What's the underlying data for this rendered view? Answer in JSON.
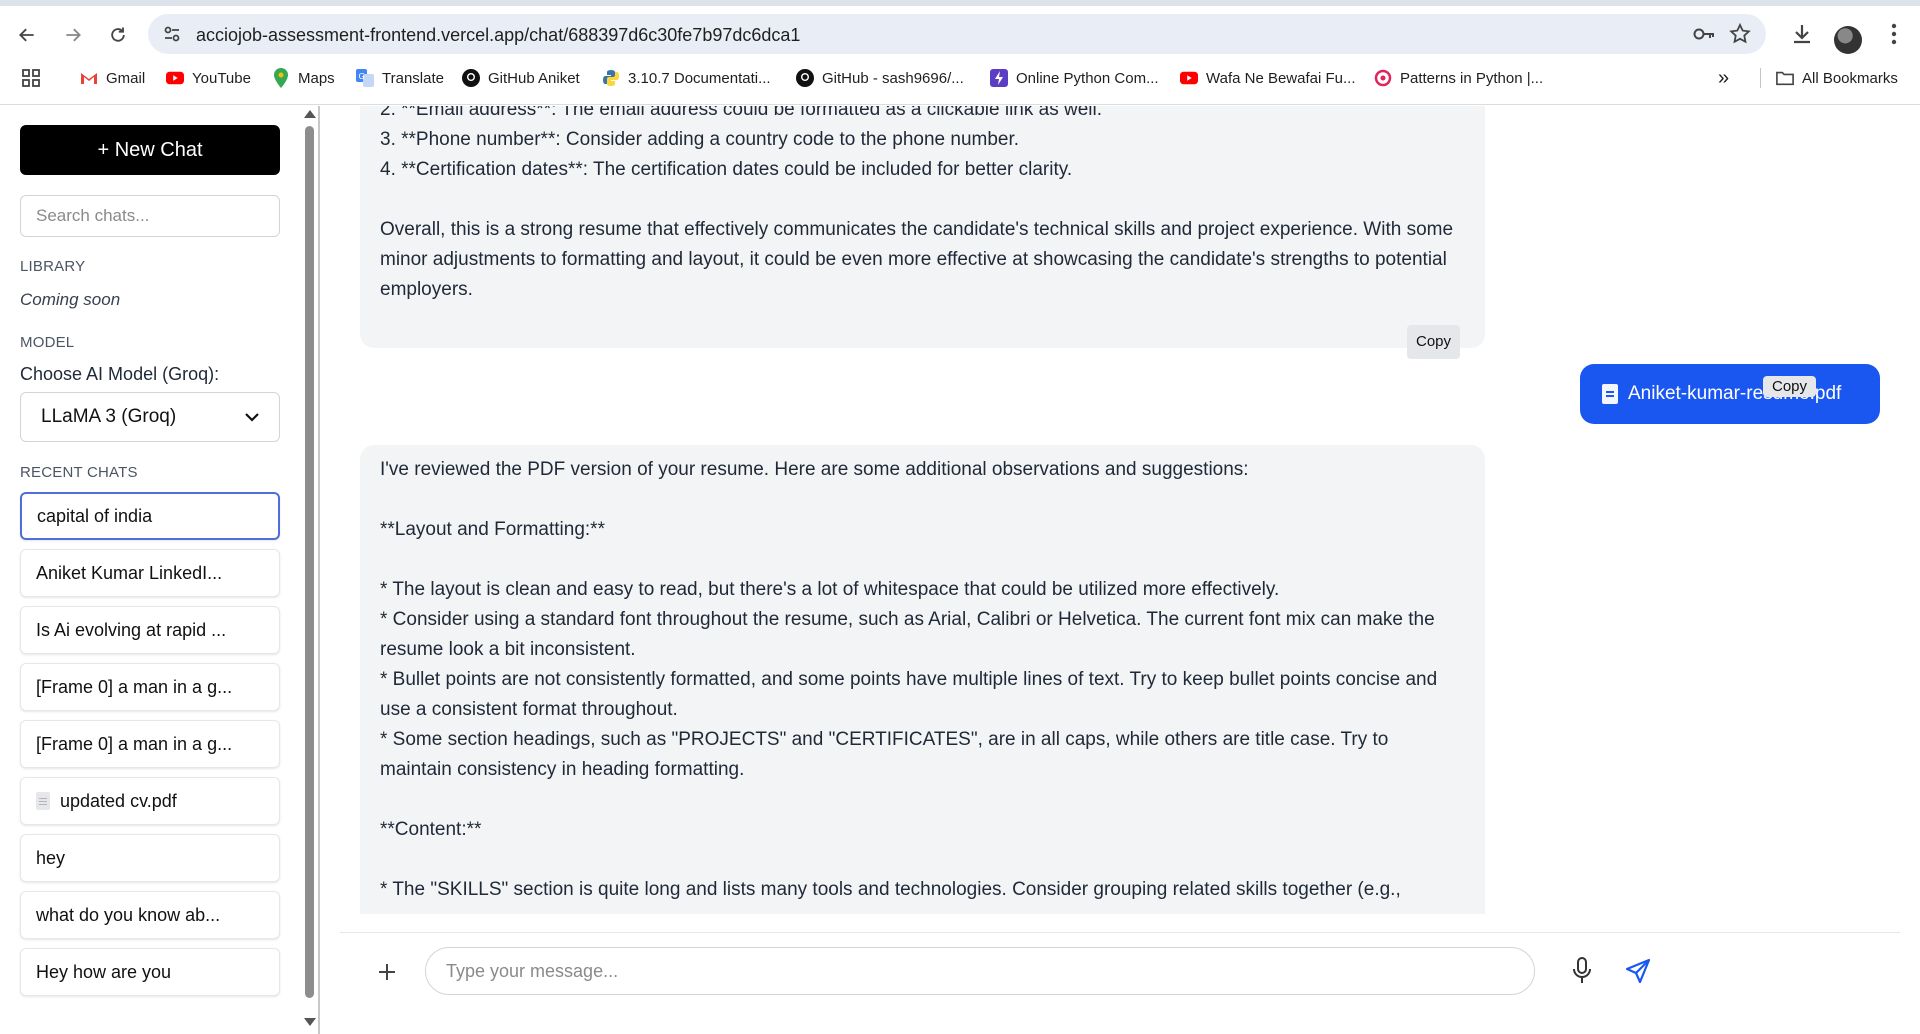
{
  "browser": {
    "url": "acciojob-assessment-frontend.vercel.app/chat/688397d6c30fe7b97dc6dca1",
    "bookmarks": [
      {
        "label": "Gmail",
        "icon": "gmail-icon"
      },
      {
        "label": "YouTube",
        "icon": "youtube-icon"
      },
      {
        "label": "Maps",
        "icon": "maps-icon"
      },
      {
        "label": "Translate",
        "icon": "translate-icon"
      },
      {
        "label": "GitHub Aniket",
        "icon": "github-icon"
      },
      {
        "label": "3.10.7 Documentati...",
        "icon": "python-icon"
      },
      {
        "label": "GitHub - sash9696/...",
        "icon": "github-icon"
      },
      {
        "label": "Online Python Com...",
        "icon": "bolt-icon"
      },
      {
        "label": "Wafa Ne Bewafai Fu...",
        "icon": "youtube-icon"
      },
      {
        "label": "Patterns in Python |...",
        "icon": "patterns-icon"
      }
    ],
    "overflow": "»",
    "all_bookmarks": "All Bookmarks"
  },
  "sidebar": {
    "new_chat": "+ New Chat",
    "search_placeholder": "Search chats...",
    "library_label": "LIBRARY",
    "library_text": "Coming soon",
    "model_label": "MODEL",
    "choose_label": "Choose AI Model (Groq):",
    "model_selected": "LLaMA 3 (Groq)",
    "recent_label": "RECENT CHATS",
    "chats": [
      {
        "title": "capital of india",
        "active": true
      },
      {
        "title": "Aniket Kumar LinkedI..."
      },
      {
        "title": "Is Ai evolving at rapid ..."
      },
      {
        "title": "[Frame 0] a man in a g..."
      },
      {
        "title": "[Frame 0] a man in a g..."
      },
      {
        "title": "updated cv.pdf",
        "file": true
      },
      {
        "title": "hey"
      },
      {
        "title": "what do you know ab..."
      },
      {
        "title": "Hey how are you"
      }
    ]
  },
  "messages": {
    "ai1": "2. **Email address**: The email address could be formatted as a clickable link as well.\n3. **Phone number**: Consider adding a country code to the phone number.\n4. **Certification dates**: The certification dates could be included for better clarity.\n\nOverall, this is a strong resume that effectively communicates the candidate's technical skills and project experience. With some minor adjustments to formatting and layout, it could be even more effective at showcasing the candidate's strengths to potential employers.",
    "user_file": "Aniket-kumar-resume.pdf",
    "ai2": "I've reviewed the PDF version of your resume. Here are some additional observations and suggestions:\n\n**Layout and Formatting:**\n\n* The layout is clean and easy to read, but there's a lot of whitespace that could be utilized more effectively.\n* Consider using a standard font throughout the resume, such as Arial, Calibri or Helvetica. The current font mix can make the resume look a bit inconsistent.\n* Bullet points are not consistently formatted, and some points have multiple lines of text. Try to keep bullet points concise and use a consistent format throughout.\n* Some section headings, such as \"PROJECTS\" and \"CERTIFICATES\", are in all caps, while others are title case. Try to maintain consistency in heading formatting.\n\n**Content:**\n\n* The \"SKILLS\" section is quite long and lists many tools and technologies. Consider grouping related skills together (e.g.,",
    "copy_label": "Copy"
  },
  "composer": {
    "placeholder": "Type your message..."
  },
  "colors": {
    "accent": "#1a56f0",
    "new_chat_bg": "#000000",
    "active_chat_border": "#4f6ed8",
    "ai_bubble_bg": "#f3f4f6"
  }
}
